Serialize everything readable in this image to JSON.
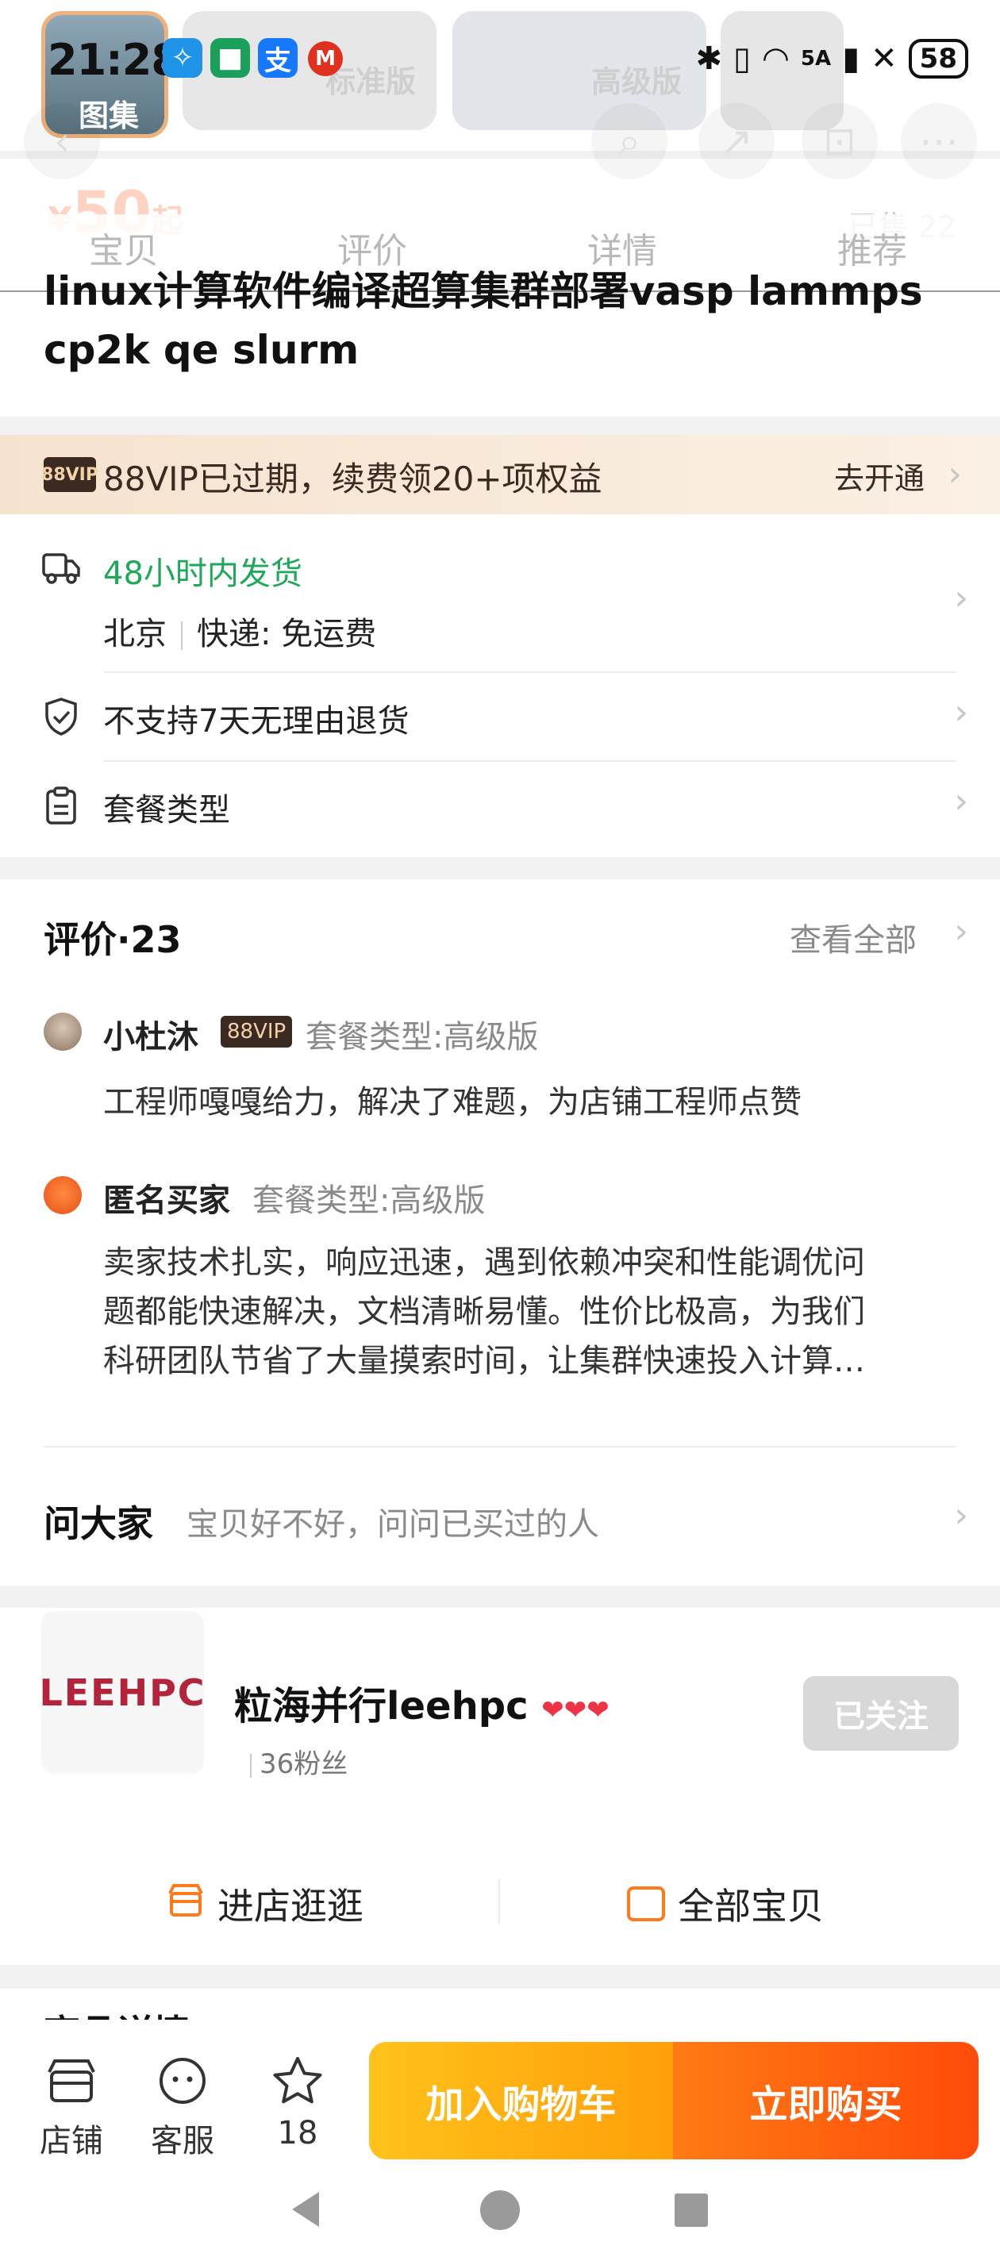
{
  "status_bar": {
    "time": "21:28",
    "battery": "58",
    "network": "5A",
    "thumb_labels": [
      "图集",
      "标准版",
      "高级版"
    ]
  },
  "tabs": [
    "宝贝",
    "评价",
    "详情",
    "推荐"
  ],
  "product": {
    "price_prefix": "¥",
    "price": "50",
    "price_suffix": "起",
    "sold": "已售 22",
    "title": "linux计算软件编译超算集群部署vasp lammps cp2k qe  slurm"
  },
  "vip_bar": {
    "badge": "88VIP",
    "text": "88VIP已过期，续费领20+项权益",
    "action": "去开通"
  },
  "shipping": {
    "headline": "48小时内发货",
    "origin": "北京",
    "express": "快递: 免运费"
  },
  "returns": "不支持7天无理由退货",
  "package_label": "套餐类型",
  "reviews": {
    "title": "评价·23",
    "view_all": "查看全部",
    "items": [
      {
        "name": "小杜沐",
        "badge": "88VIP",
        "package": "套餐类型:高级版",
        "text": "工程师嘎嘎给力，解决了难题，为店铺工程师点赞"
      },
      {
        "name": "匿名买家",
        "badge": "",
        "package": "套餐类型:高级版",
        "text_lines": [
          "卖家技术扎实，响应迅速，遇到依赖冲突和性能调优问",
          "题都能快速解决，文档清晰易懂。性价比极高，为我们",
          "科研团队节省了大量摸索时间，让集群快速投入计算…"
        ]
      }
    ]
  },
  "ask": {
    "title": "问大家",
    "prompt": "宝贝好不好，问问已买过的人"
  },
  "shop": {
    "logo_text": "LEEHPC",
    "name": "粒海并行leehpc",
    "hearts": "❤❤❤",
    "fans": "36粉丝",
    "follow": "已关注",
    "enter": "进店逛逛",
    "all_items": "全部宝贝"
  },
  "peek_section": "商品详情",
  "bottom_bar": {
    "store": "店铺",
    "service": "客服",
    "favorites": "18",
    "add_cart": "加入购物车",
    "buy_now": "立即购买"
  },
  "colors": {
    "accent_orange": "#ff5a0a",
    "cart_yellow": "#ffb414",
    "green": "#1fa85a",
    "vip_brown": "#3a2a22"
  }
}
